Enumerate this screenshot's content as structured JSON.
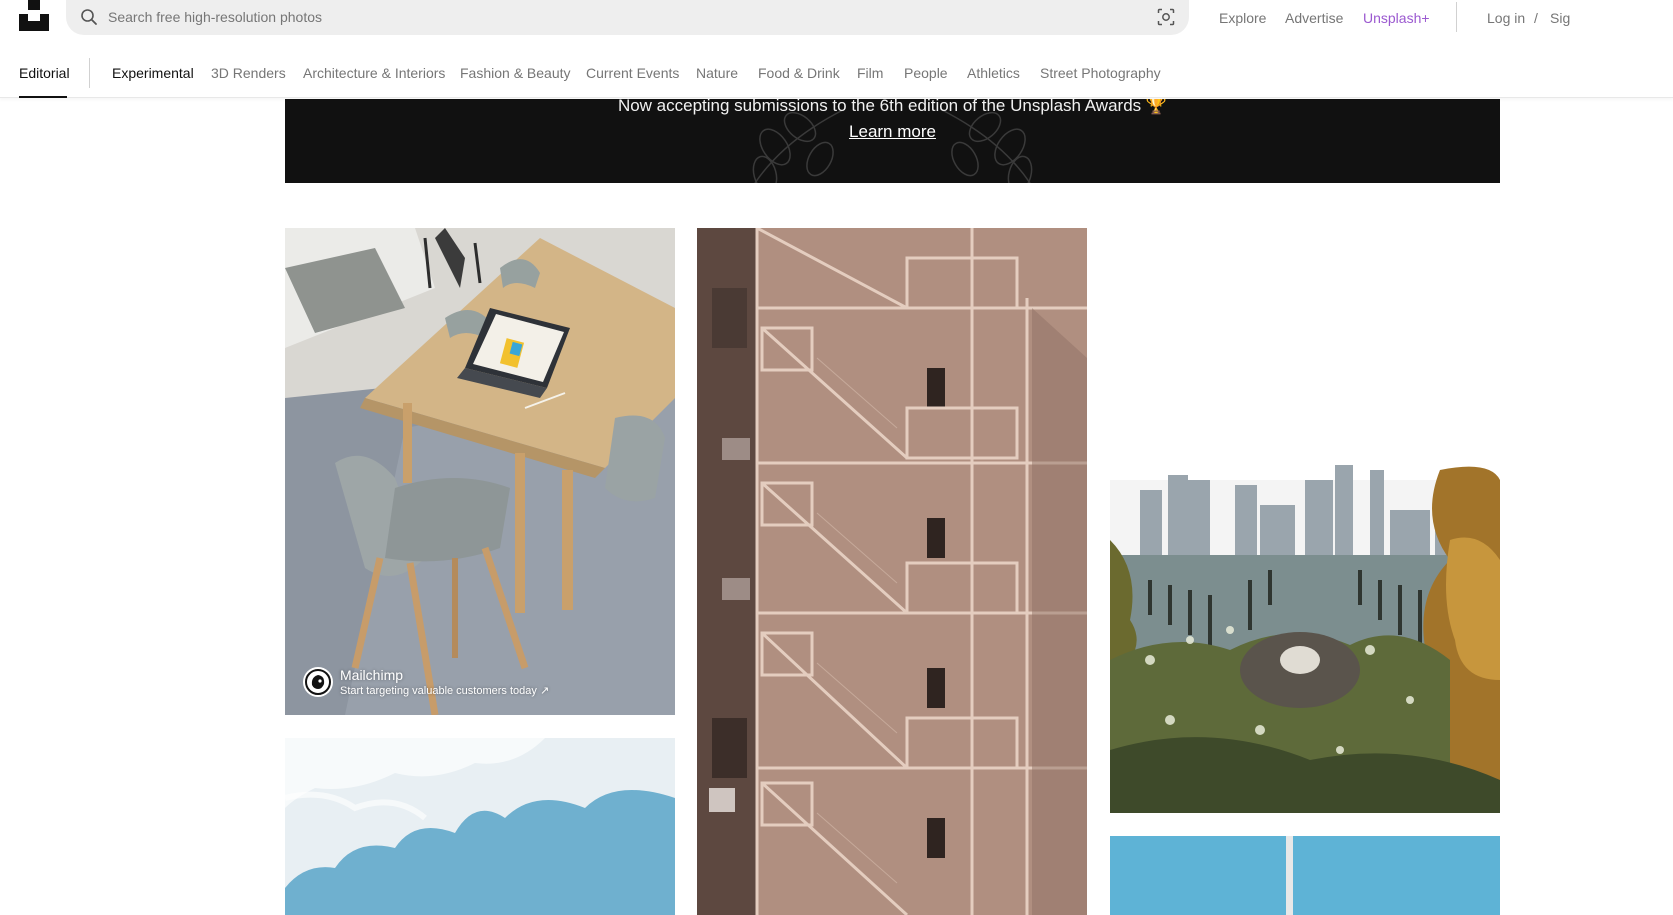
{
  "header": {
    "search_placeholder": "Search free high-resolution photos",
    "nav": {
      "explore": "Explore",
      "advertise": "Advertise",
      "unsplash_plus": "Unsplash+",
      "login": "Log in",
      "separator": "/",
      "signup": "Sig"
    }
  },
  "topics": {
    "items": [
      "Editorial",
      "Experimental",
      "3D Renders",
      "Architecture & Interiors",
      "Fashion & Beauty",
      "Current Events",
      "Nature",
      "Food & Drink",
      "Film",
      "People",
      "Athletics",
      "Street Photography"
    ],
    "active": "Editorial"
  },
  "banner": {
    "text": "Now accepting submissions to the 6th edition of the Unsplash Awards 🏆",
    "link": "Learn more"
  },
  "photos": {
    "ad": {
      "name": "Mailchimp",
      "tagline": "Start targeting valuable customers today ↗"
    }
  },
  "colors": {
    "accent_plus": "#9b59d0",
    "banner_bg": "#111111",
    "muted_text": "#767676"
  }
}
